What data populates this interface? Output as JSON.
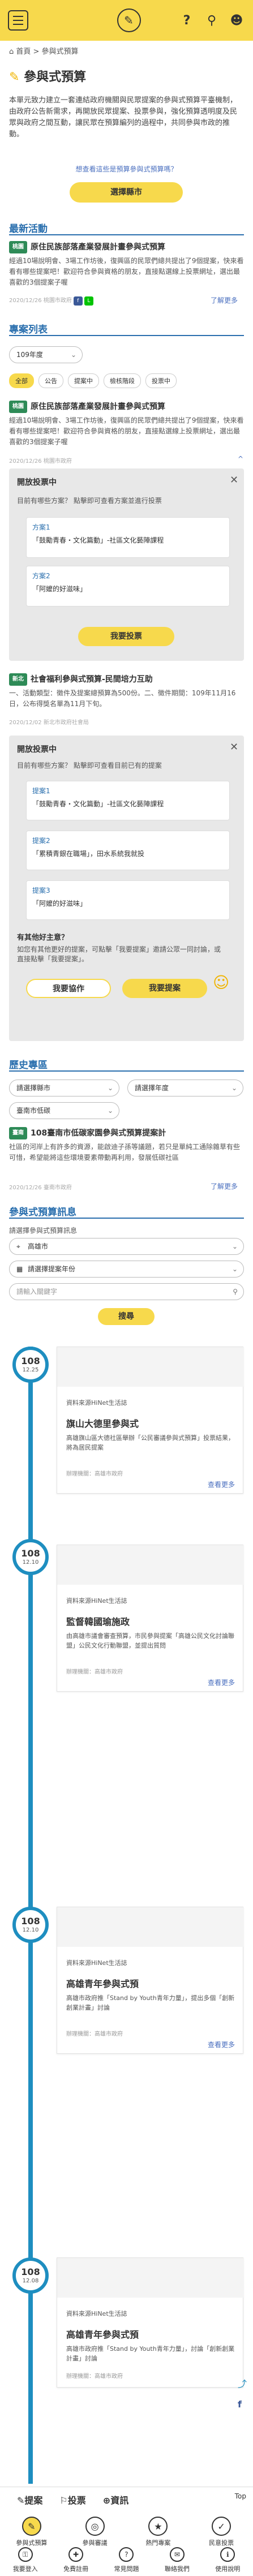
{
  "header": {
    "menu_label": "☰",
    "logo": "✎",
    "help": "?",
    "search": "🔍",
    "user": "👤"
  },
  "breadcrumb": "⌂ 首頁 > 參與式預算",
  "page_title": "參與式預算",
  "intro": "本單元致力建立一套連結政府機關與民眾提案的參與式預算平臺機制，由政府公告新需求，再開放民眾提案、投票參與，強化預算透明度及民眾與政府之間互動，讓民眾在預算編列的過程中，共同參與市政的推動。",
  "intro_link": "想查看這些是預算參與式預算嗎？",
  "select_city_btn": "選擇縣市",
  "latest": {
    "heading": "最新活動",
    "tag": "桃園",
    "title": "原住民族部落產業發展計畫參與式預算",
    "body": "經過10場說明會、3場工作坊後，復興區的民眾們總共提出了9個提案，快來看看有哪些提案吧！歡迎符合參與資格的朋友，直接點選線上投票網址，選出最喜歡的3個提案子喔",
    "meta": "2020/12/26 桃園市政府",
    "more": "了解更多"
  },
  "projects": {
    "heading": "專案列表",
    "year": "109年度",
    "filters": [
      "全部",
      "公告",
      "提案中",
      "檢核階段",
      "投票中"
    ],
    "item1": {
      "tag": "桃園",
      "title": "原住民族部落產業發展計畫參與式預算",
      "body": "經過10場說明會、3場工作坊後，復興區的民眾們總共提出了9個提案，快來看看有哪些提案吧！歡迎符合參與資格的朋友，直接點選線上投票網址，選出最喜歡的3個提案子喔",
      "meta": "2020/12/26 桃園市政府"
    },
    "vote_panel": {
      "title": "開放投票中",
      "sub": "目前有哪些方案？ 點擊即可查看方案並進行投票",
      "options": [
        {
          "no": "方案1",
          "title": "「鼓勵青春・文化篇動」-社區文化藝陣課程"
        },
        {
          "no": "方案2",
          "title": "「阿嬤的好滋味」"
        }
      ],
      "button": "我要投票"
    },
    "item2": {
      "tag": "新北",
      "title": "社會福利參與式預算-民間培力互助",
      "body": "一、活動類型：徵件及提案總預算為500份。二、徵件期間：109年11月16日，公布得獎名單為11月下旬。",
      "meta": "2020/12/02 新北市政府社會局"
    },
    "vote_panel2": {
      "title": "開放投票中",
      "sub": "目前有哪些方案？ 點擊即可查看目前已有的提案",
      "options": [
        {
          "no": "提案1",
          "title": "「鼓勵青春・文化篇動」-社區文化藝陣課程"
        },
        {
          "no": "提案2",
          "title": "「累積青銀在職場」，田水系統我就投"
        },
        {
          "no": "提案3",
          "title": "「阿嬤的好滋味」"
        }
      ],
      "idea_title": "有其他好主意？",
      "idea_body": "如您有其他更好的提案，可點擊「我要提案」邀請公眾一同討論，或直接點擊「我要提案」。",
      "btn_collab": "我要協作",
      "btn_propose": "我要提案"
    }
  },
  "history": {
    "heading": "歷史專區",
    "select_city": "請選擇縣市",
    "select_year": "請選擇年度",
    "select_agency": "臺南市低碳",
    "tag": "臺南",
    "title": "108臺南市低碳家園參與式預算提案計",
    "body": "社區的河岸上有許多的資源，能啟迪子孫等議題，若只是單純工通除雜草有些可惜，希望能將這些環境要素帶動再利用，發展低碳社區",
    "meta": "2020/12/26 臺南市政府",
    "more": "了解更多"
  },
  "info": {
    "heading": "參與式預算訊息",
    "label": "請選擇參與式預算訊息",
    "select_city": "高雄市",
    "select_year": "請選擇提案年份",
    "keyword_ph": "請輸入關鍵字",
    "search_btn": "搜尋"
  },
  "timeline": [
    {
      "year": "108",
      "date": "12.25",
      "src": "資料來源HiNet生活誌",
      "title": "旗山大德里參與式",
      "body": "高雄旗山區大德社區舉辦「公民審議參與式預算」投票結果，將為居民提案",
      "meta": "辦理機關：高雄市政府",
      "more": "查看更多"
    },
    {
      "year": "108",
      "date": "12.10",
      "src": "資料來源HiNet生活誌",
      "title": "監督韓國瑜施政",
      "body": "由高雄市議會審查預算，市民參與提案「高雄公民文化討論聯盟」公民文化行動聯盟，並提出質問",
      "meta": "辦理機關：高雄市政府",
      "more": "查看更多"
    },
    {
      "year": "108",
      "date": "12.10",
      "src": "資料來源HiNet生活誌",
      "title": "高雄青年參與式預",
      "body": "高雄市政府推「Stand by Youth青年力量」，提出多個「創新創業計畫」討論",
      "meta": "辦理機關：高雄市政府",
      "more": "查看更多"
    },
    {
      "year": "108",
      "date": "12.08",
      "src": "資料來源HiNet生活誌",
      "title": "高雄青年參與式預",
      "body": "高雄市政府推「Stand by Youth青年力量」，討論「創新創業計畫」討論",
      "meta": "辦理機關：高雄市政府",
      "more": "查看更多"
    }
  ],
  "bottom_actions": {
    "propose": "提案",
    "vote": "投票",
    "info": "資訊",
    "top": "Top"
  },
  "nav1": [
    "參與式預算",
    "參與審議",
    "熱門專案",
    "民意投票"
  ],
  "nav2": [
    "我要登入",
    "免費註冊",
    "常見問題",
    "聯絡我們",
    "使用說明"
  ]
}
